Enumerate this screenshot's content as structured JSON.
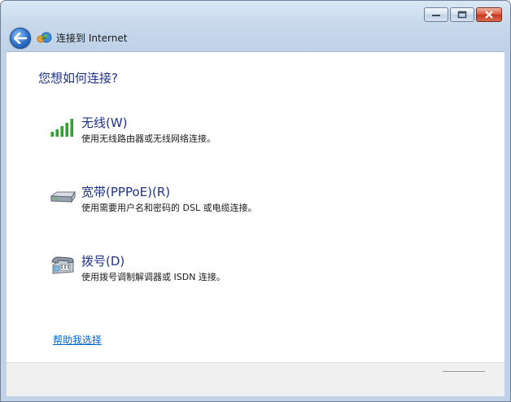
{
  "window": {
    "title": "连接到 Internet",
    "buttons": {
      "minimize_icon": "minimize-icon",
      "maximize_icon": "maximize-icon",
      "close_icon": "close-icon"
    }
  },
  "main": {
    "heading": "您想如何连接?",
    "options": [
      {
        "title": "无线(W)",
        "description": "使用无线路由器或无线网络连接。",
        "icon": "wireless-signal-icon"
      },
      {
        "title": "宽带(PPPoE)(R)",
        "description": "使用需要用户名和密码的 DSL 或电缆连接。",
        "icon": "broadband-modem-icon"
      },
      {
        "title": "拨号(D)",
        "description": "使用拨号调制解调器或 ISDN 连接。",
        "icon": "dialup-phone-icon"
      }
    ],
    "help_link": "帮助我选择"
  },
  "colors": {
    "heading": "#1e3287",
    "link": "#0066cc",
    "signal_green": "#2e9b2e"
  }
}
